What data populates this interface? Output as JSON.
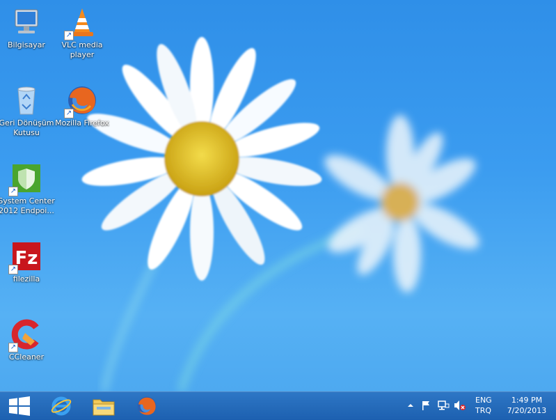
{
  "desktop": {
    "icons": [
      {
        "label": "Bilgisayar",
        "icon": "computer-icon"
      },
      {
        "label": "VLC media\nplayer",
        "icon": "vlc-icon"
      },
      {
        "label": "Geri Dönüşüm\nKutusu",
        "icon": "recycle-bin-icon"
      },
      {
        "label": "Mozilla Firefox",
        "icon": "firefox-icon"
      },
      {
        "label": "System Center\n2012 Endpoi...",
        "icon": "shield-icon"
      },
      {
        "label": "filezilla",
        "icon": "filezilla-icon"
      },
      {
        "label": "CCleaner",
        "icon": "ccleaner-icon"
      }
    ]
  },
  "taskbar": {
    "pinned": [
      "start-icon",
      "internet-explorer-icon",
      "file-explorer-icon",
      "firefox-icon"
    ],
    "tray": {
      "language": "ENG",
      "keyboard": "TRQ",
      "time": "1:49 PM",
      "date": "7/20/2013"
    }
  },
  "colors": {
    "accent": "#2f8fe8",
    "taskbar": "#1f5fa8"
  }
}
